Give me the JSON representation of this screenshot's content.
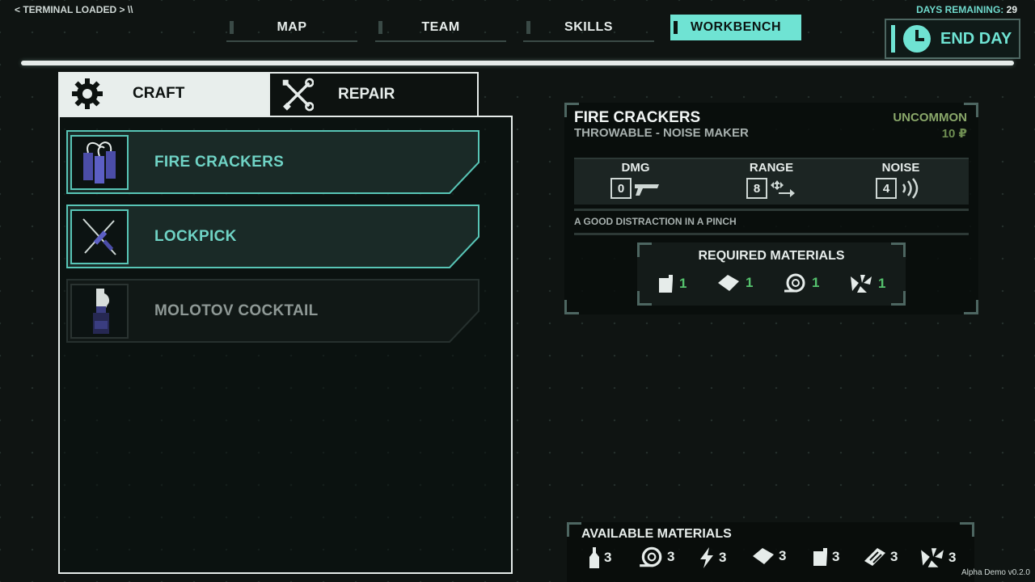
{
  "header": {
    "terminal_label": "< TERMINAL LOADED > \\\\",
    "days_label": "DAYS REMAINING:",
    "days_value": "29",
    "end_day_label": "END DAY"
  },
  "nav": {
    "tabs": [
      {
        "label": "MAP",
        "active": false
      },
      {
        "label": "TEAM",
        "active": false
      },
      {
        "label": "SKILLS",
        "active": false
      },
      {
        "label": "WORKBENCH",
        "active": true
      }
    ]
  },
  "modes": {
    "craft_label": "CRAFT",
    "repair_label": "REPAIR",
    "active": "CRAFT"
  },
  "recipes": [
    {
      "name": "FIRE CRACKERS",
      "icon": "fire-crackers-icon",
      "available": true
    },
    {
      "name": "LOCKPICK",
      "icon": "lockpick-icon",
      "available": true
    },
    {
      "name": "MOLOTOV COCKTAIL",
      "icon": "molotov-icon",
      "available": false
    }
  ],
  "detail": {
    "title": "FIRE CRACKERS",
    "subtitle": "THROWABLE - NOISE MAKER",
    "rarity": "UNCOMMON",
    "price": "10 ₽",
    "stats": [
      {
        "label": "DMG",
        "value": "0",
        "icon": "gun-icon"
      },
      {
        "label": "RANGE",
        "value": "8",
        "icon": "range-icon"
      },
      {
        "label": "NOISE",
        "value": "4",
        "icon": "noise-icon"
      }
    ],
    "description": "A GOOD DISTRACTION IN A PINCH",
    "required_title": "REQUIRED MATERIALS",
    "required": [
      {
        "icon": "canister-icon",
        "count": "1"
      },
      {
        "icon": "cloth-icon",
        "count": "1"
      },
      {
        "icon": "rope-icon",
        "count": "1"
      },
      {
        "icon": "scrap-icon",
        "count": "1"
      }
    ]
  },
  "available_materials": {
    "title": "AVAILABLE MATERIALS",
    "items": [
      {
        "icon": "bottle-icon",
        "count": "3"
      },
      {
        "icon": "rope-icon",
        "count": "3"
      },
      {
        "icon": "electric-icon",
        "count": "3"
      },
      {
        "icon": "cloth-icon",
        "count": "3"
      },
      {
        "icon": "canister-icon",
        "count": "3"
      },
      {
        "icon": "tape-icon",
        "count": "3"
      },
      {
        "icon": "scrap-icon",
        "count": "3"
      }
    ]
  },
  "version": "Alpha Demo  v0.2.0",
  "colors": {
    "accent": "#6fe3d3",
    "rarity": "#8aa86a",
    "material_count": "#55c26d",
    "background": "#0f1412"
  }
}
